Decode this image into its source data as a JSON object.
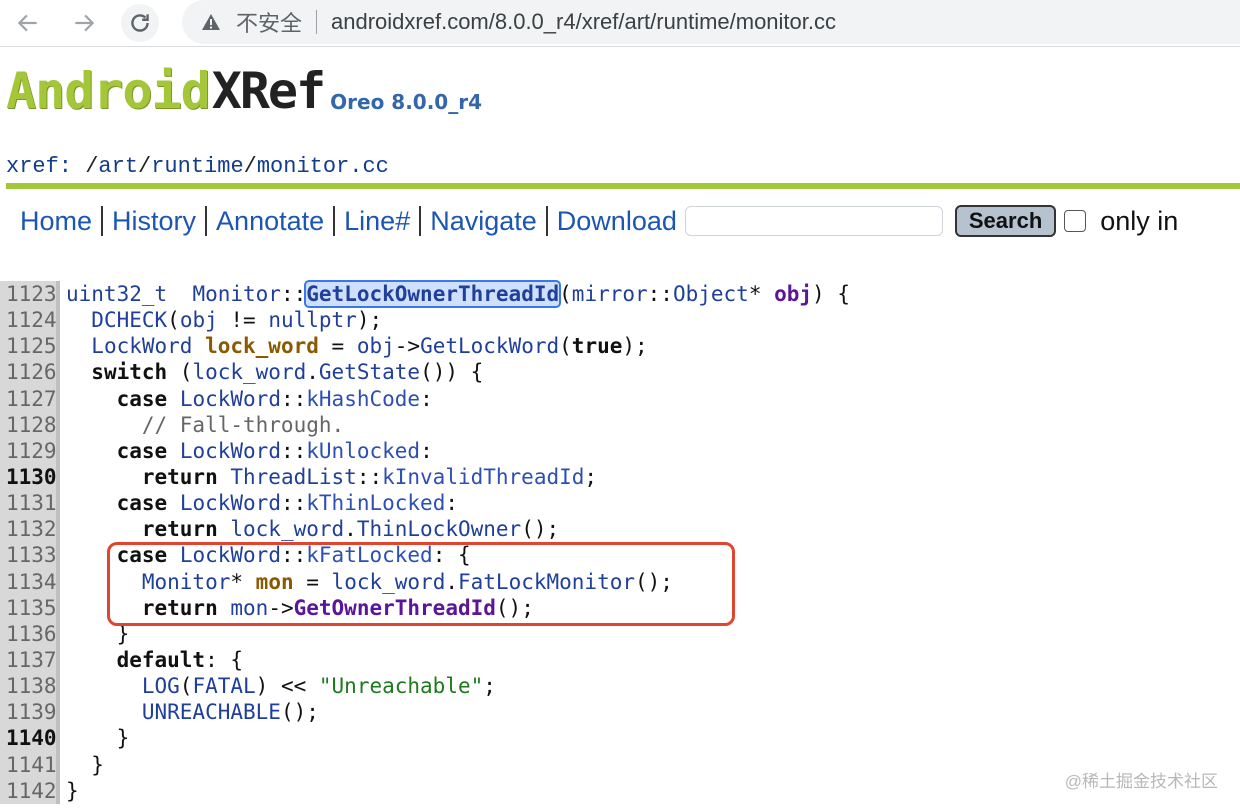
{
  "browser": {
    "insecure_label": "不安全",
    "url": "androidxref.com/8.0.0_r4/xref/art/runtime/monitor.cc"
  },
  "header": {
    "logo_android": "Android",
    "logo_xref": "XRef",
    "version": "Oreo 8.0.0_r4",
    "crumb_prefix": "xref:",
    "crumbs": [
      "art",
      "runtime",
      "monitor.cc"
    ]
  },
  "menu": {
    "home": "Home",
    "history": "History",
    "annotate": "Annotate",
    "line": "Line#",
    "navigate": "Navigate",
    "download": "Download",
    "search_value": "",
    "search_button": "Search",
    "only_in_label": "only in"
  },
  "code": {
    "lines": [
      {
        "n": "1123",
        "bold": false,
        "parts": [
          [
            "ty",
            "uint32_t"
          ],
          [
            "",
            "  "
          ],
          [
            "ty",
            "Monitor"
          ],
          [
            "",
            "::"
          ],
          [
            "hl",
            "GetLockOwnerThreadId"
          ],
          [
            "",
            "("
          ],
          [
            "ns",
            "mirror"
          ],
          [
            "",
            "::"
          ],
          [
            "ty",
            "Object"
          ],
          [
            "",
            "* "
          ],
          [
            "pm",
            "obj"
          ],
          [
            "",
            ") {"
          ]
        ]
      },
      {
        "n": "1124",
        "bold": false,
        "parts": [
          [
            "",
            "  "
          ],
          [
            "fn",
            "DCHECK"
          ],
          [
            "",
            "("
          ],
          [
            "ty",
            "obj"
          ],
          [
            "",
            " != "
          ],
          [
            "fn",
            "nullptr"
          ],
          [
            "",
            ");"
          ]
        ]
      },
      {
        "n": "1125",
        "bold": false,
        "parts": [
          [
            "",
            "  "
          ],
          [
            "ty",
            "LockWord"
          ],
          [
            "lv",
            " lock_word"
          ],
          [
            "",
            " = "
          ],
          [
            "ty",
            "obj"
          ],
          [
            "",
            "->"
          ],
          [
            "ty",
            "GetLockWord"
          ],
          [
            "",
            "("
          ],
          [
            "kw",
            "true"
          ],
          [
            "",
            ");"
          ]
        ]
      },
      {
        "n": "1126",
        "bold": false,
        "parts": [
          [
            "",
            "  "
          ],
          [
            "kw",
            "switch"
          ],
          [
            "",
            " ("
          ],
          [
            "ty",
            "lock_word"
          ],
          [
            "",
            "."
          ],
          [
            "fn",
            "GetState"
          ],
          [
            "",
            "()) {"
          ]
        ]
      },
      {
        "n": "1127",
        "bold": false,
        "parts": [
          [
            "",
            "    "
          ],
          [
            "kw",
            "case"
          ],
          [
            "",
            " "
          ],
          [
            "ty",
            "LockWord"
          ],
          [
            "",
            "::"
          ],
          [
            "cn",
            "kHashCode"
          ],
          [
            "",
            ":"
          ]
        ]
      },
      {
        "n": "1128",
        "bold": false,
        "parts": [
          [
            "",
            "      "
          ],
          [
            "cm",
            "// Fall-through."
          ]
        ]
      },
      {
        "n": "1129",
        "bold": false,
        "parts": [
          [
            "",
            "    "
          ],
          [
            "kw",
            "case"
          ],
          [
            "",
            " "
          ],
          [
            "ty",
            "LockWord"
          ],
          [
            "",
            "::"
          ],
          [
            "cn",
            "kUnlocked"
          ],
          [
            "",
            ":"
          ]
        ]
      },
      {
        "n": "1130",
        "bold": true,
        "parts": [
          [
            "",
            "      "
          ],
          [
            "kw",
            "return"
          ],
          [
            "",
            " "
          ],
          [
            "ty",
            "ThreadList"
          ],
          [
            "",
            "::"
          ],
          [
            "cn",
            "kInvalidThreadId"
          ],
          [
            "",
            ";"
          ]
        ]
      },
      {
        "n": "1131",
        "bold": false,
        "parts": [
          [
            "",
            "    "
          ],
          [
            "kw",
            "case"
          ],
          [
            "",
            " "
          ],
          [
            "ty",
            "LockWord"
          ],
          [
            "",
            "::"
          ],
          [
            "cn",
            "kThinLocked"
          ],
          [
            "",
            ":"
          ]
        ]
      },
      {
        "n": "1132",
        "bold": false,
        "parts": [
          [
            "",
            "      "
          ],
          [
            "kw",
            "return"
          ],
          [
            "",
            " "
          ],
          [
            "ty",
            "lock_word"
          ],
          [
            "",
            "."
          ],
          [
            "fn",
            "ThinLockOwner"
          ],
          [
            "",
            "();"
          ]
        ]
      },
      {
        "n": "1133",
        "bold": false,
        "parts": [
          [
            "",
            "    "
          ],
          [
            "kw",
            "case"
          ],
          [
            "",
            " "
          ],
          [
            "ty",
            "LockWord"
          ],
          [
            "",
            "::"
          ],
          [
            "cn",
            "kFatLocked"
          ],
          [
            "",
            ": {"
          ]
        ]
      },
      {
        "n": "1134",
        "bold": false,
        "parts": [
          [
            "",
            "      "
          ],
          [
            "ty",
            "Monitor"
          ],
          [
            "",
            "* "
          ],
          [
            "lv",
            "mon"
          ],
          [
            "",
            " = "
          ],
          [
            "ty",
            "lock_word"
          ],
          [
            "",
            "."
          ],
          [
            "fn",
            "FatLockMonitor"
          ],
          [
            "",
            "();"
          ]
        ]
      },
      {
        "n": "1135",
        "bold": false,
        "parts": [
          [
            "",
            "      "
          ],
          [
            "kw",
            "return"
          ],
          [
            "",
            " "
          ],
          [
            "ty",
            "mon"
          ],
          [
            "",
            "->"
          ],
          [
            "mc",
            "GetOwnerThreadId"
          ],
          [
            "",
            "();"
          ]
        ]
      },
      {
        "n": "1136",
        "bold": false,
        "parts": [
          [
            "",
            "    }"
          ]
        ]
      },
      {
        "n": "1137",
        "bold": false,
        "parts": [
          [
            "",
            "    "
          ],
          [
            "kw",
            "default"
          ],
          [
            "",
            ": {"
          ]
        ]
      },
      {
        "n": "1138",
        "bold": false,
        "parts": [
          [
            "",
            "      "
          ],
          [
            "fn",
            "LOG"
          ],
          [
            "",
            "("
          ],
          [
            "ty",
            "FATAL"
          ],
          [
            "",
            ") << "
          ],
          [
            "st",
            "\"Unreachable\""
          ],
          [
            "",
            ";"
          ]
        ]
      },
      {
        "n": "1139",
        "bold": false,
        "parts": [
          [
            "",
            "      "
          ],
          [
            "fn",
            "UNREACHABLE"
          ],
          [
            "",
            "();"
          ]
        ]
      },
      {
        "n": "1140",
        "bold": true,
        "parts": [
          [
            "",
            "    }"
          ]
        ]
      },
      {
        "n": "1141",
        "bold": false,
        "parts": [
          [
            "",
            "  }"
          ]
        ]
      },
      {
        "n": "1142",
        "bold": false,
        "parts": [
          [
            "",
            "}"
          ]
        ]
      }
    ]
  },
  "watermark": "@稀土掘金技术社区"
}
